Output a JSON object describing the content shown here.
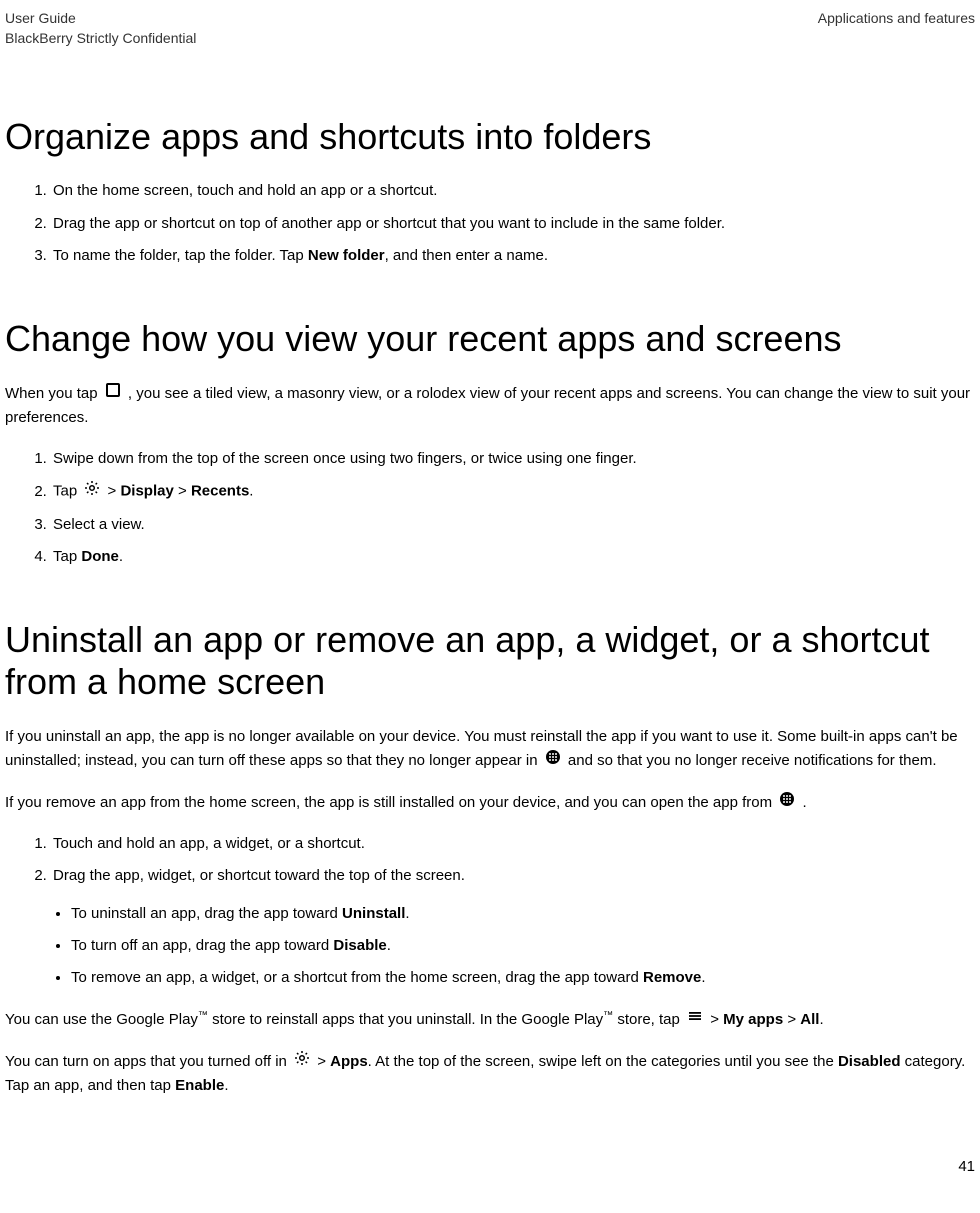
{
  "header": {
    "guide": "User Guide",
    "confidential": "BlackBerry Strictly Confidential",
    "section": "Applications and features"
  },
  "sections": {
    "organize": {
      "title": "Organize apps and shortcuts into folders",
      "steps": {
        "s1": "On the home screen, touch and hold an app or a shortcut.",
        "s2": "Drag the app or shortcut on top of another app or shortcut that you want to include in the same folder.",
        "s3a": "To name the folder, tap the folder. Tap ",
        "s3b": "New folder",
        "s3c": ", and then enter a name."
      }
    },
    "change": {
      "title": "Change how you view your recent apps and screens",
      "intro_a": "When you tap ",
      "intro_b": " , you see a tiled view, a masonry view, or a rolodex view of your recent apps and screens. You can change the view to suit your preferences.",
      "steps": {
        "s1": "Swipe down from the top of the screen once using two fingers, or twice using one finger.",
        "s2a": "Tap ",
        "s2b": "  > ",
        "s2c": "Display",
        "s2d": " > ",
        "s2e": "Recents",
        "s2f": ".",
        "s3": "Select a view.",
        "s4a": "Tap ",
        "s4b": "Done",
        "s4c": "."
      }
    },
    "uninstall": {
      "title": "Uninstall an app or remove an app, a widget, or a shortcut from a home screen",
      "p1a": "If you uninstall an app, the app is no longer available on your device. You must reinstall the app if you want to use it. Some built-in apps can't be uninstalled; instead, you can turn off these apps so that they no longer appear in ",
      "p1b": "  and so that you no longer receive notifications for them.",
      "p2a": "If you remove an app from the home screen, the app is still installed on your device, and you can open the app from ",
      "p2b": " .",
      "steps": {
        "s1": "Touch and hold an app, a widget, or a shortcut.",
        "s2": "Drag the app, widget, or shortcut toward the top of the screen."
      },
      "bullets": {
        "b1a": "To uninstall an app, drag the app toward ",
        "b1b": "Uninstall",
        "b1c": ".",
        "b2a": "To turn off an app, drag the app toward ",
        "b2b": "Disable",
        "b2c": ".",
        "b3a": "To remove an app, a widget, or a shortcut from the home screen, drag the app toward ",
        "b3b": "Remove",
        "b3c": "."
      },
      "p3a": "You can use the Google Play",
      "p3b": " store to reinstall apps that you uninstall. In the Google Play",
      "p3c": " store, tap ",
      "p3d": "  > ",
      "p3e": "My apps",
      "p3f": " > ",
      "p3g": "All",
      "p3h": ".",
      "p4a": "You can turn on apps that you turned off in ",
      "p4b": "  > ",
      "p4c": "Apps",
      "p4d": ". At the top of the screen, swipe left on the categories until you see the ",
      "p4e": "Disabled",
      "p4f": " category. Tap an app, and then tap ",
      "p4g": "Enable",
      "p4h": "."
    }
  },
  "tm": "™",
  "page_number": "41"
}
